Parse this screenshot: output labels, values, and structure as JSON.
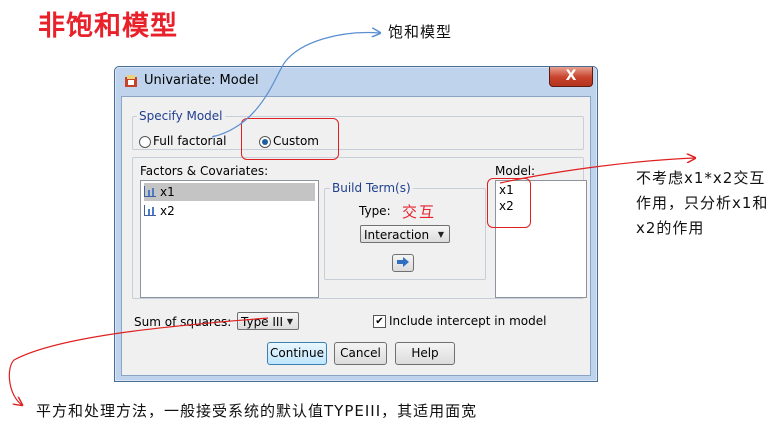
{
  "slide": {
    "title": "非饱和模型",
    "note_top": "饱和模型",
    "note_right": "不考虑x1*x2交互作用，只分析x1和x2的作用",
    "note_bottom": "平方和处理方法，一般接受系统的默认值TYPEIII，其适用面宽",
    "annotation_type": "交互"
  },
  "dialog": {
    "title": "Univariate: Model",
    "close_label": "X",
    "specify_model": {
      "legend": "Specify Model",
      "full_factorial": "Full factorial",
      "custom": "Custom",
      "selected": "Custom"
    },
    "factors_label": "Factors & Covariates:",
    "factors": [
      "x1",
      "x2"
    ],
    "build_term": {
      "legend": "Build Term(s)",
      "type_label": "Type:",
      "type_value": "Interaction",
      "move_icon": "right-arrow-icon"
    },
    "model_label": "Model:",
    "model_terms": [
      "x1",
      "x2"
    ],
    "sum_of_squares_label": "Sum of squares:",
    "sum_of_squares_value": "Type III",
    "include_intercept_label": "Include intercept in model",
    "include_intercept": true,
    "buttons": {
      "continue": "Continue",
      "cancel": "Cancel",
      "help": "Help"
    }
  },
  "colors": {
    "accent_red": "#e8212b",
    "dialog_frame": "#bfd3ec",
    "arrow_blue": "#5b8fd0"
  }
}
